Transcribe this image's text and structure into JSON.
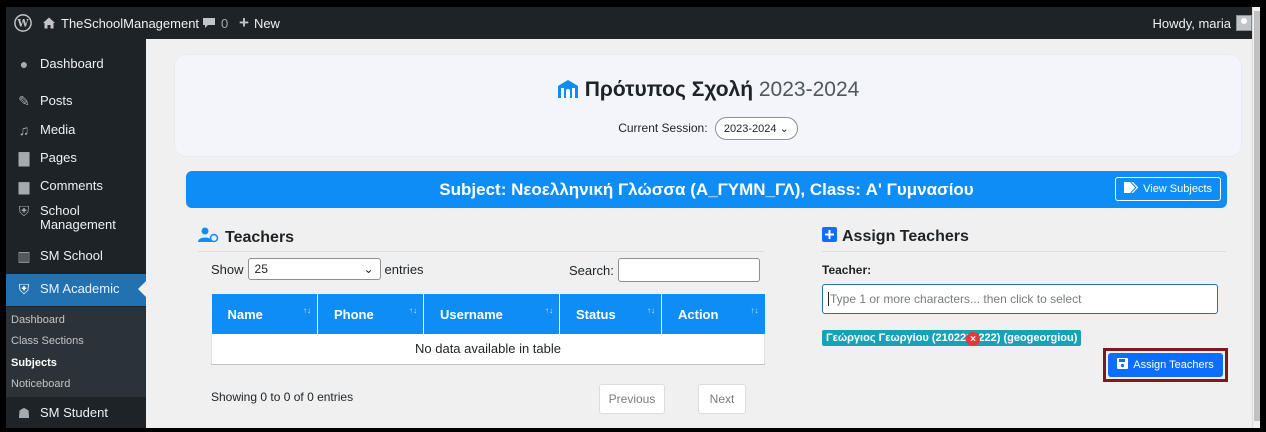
{
  "admin_bar": {
    "site_name": "TheSchoolManagement",
    "comments_count": "0",
    "new_label": "New",
    "howdy": "Howdy, maria"
  },
  "sidebar": {
    "items": [
      {
        "label": "Dashboard",
        "icon": "dashboard-icon"
      },
      {
        "label": "Posts",
        "icon": "pin-icon"
      },
      {
        "label": "Media",
        "icon": "media-icon"
      },
      {
        "label": "Pages",
        "icon": "pages-icon"
      },
      {
        "label": "Comments",
        "icon": "comments-icon"
      },
      {
        "label": "School Management",
        "icon": "school-icon"
      },
      {
        "label": "SM School",
        "icon": "building-icon"
      },
      {
        "label": "SM Academic",
        "icon": "graduation-cap-icon"
      },
      {
        "label": "SM Student",
        "icon": "students-icon"
      }
    ],
    "submenu": [
      "Dashboard",
      "Class Sections",
      "Subjects",
      "Noticeboard"
    ],
    "active_submenu": "Subjects"
  },
  "header": {
    "school_name": "Πρότυπος Σχολή",
    "school_year": "2023-2024",
    "session_label": "Current Session:",
    "session_value": "2023-2024"
  },
  "subject_bar": {
    "title": "Subject: Νεοελληνική Γλώσσα (Α_ΓΥΜΝ_ΓΛ), Class: Α' Γυμνασίου",
    "view_subjects": "View Subjects"
  },
  "teachers": {
    "heading": "Teachers",
    "show_label": "Show",
    "entries_value": "25",
    "entries_label": "entries",
    "search_label": "Search:",
    "columns": [
      "Name",
      "Phone",
      "Username",
      "Status",
      "Action"
    ],
    "empty_message": "No data available in table",
    "showing": "Showing 0 to 0 of 0 entries",
    "prev": "Previous",
    "next": "Next"
  },
  "assign": {
    "heading": "Assign Teachers",
    "teacher_label": "Teacher:",
    "placeholder": "Type 1 or more characters... then click to select",
    "selected": "Γεώργιος Γεωργίου (2102222222) (geogeorgiou)",
    "remove_symbol": "×",
    "button": "Assign Teachers"
  },
  "colors": {
    "wp_dark": "#1d2327",
    "wp_blue": "#2271b1",
    "primary": "#0d8df5",
    "chip": "#17a2b8",
    "highlight": "#7b1b1b"
  }
}
